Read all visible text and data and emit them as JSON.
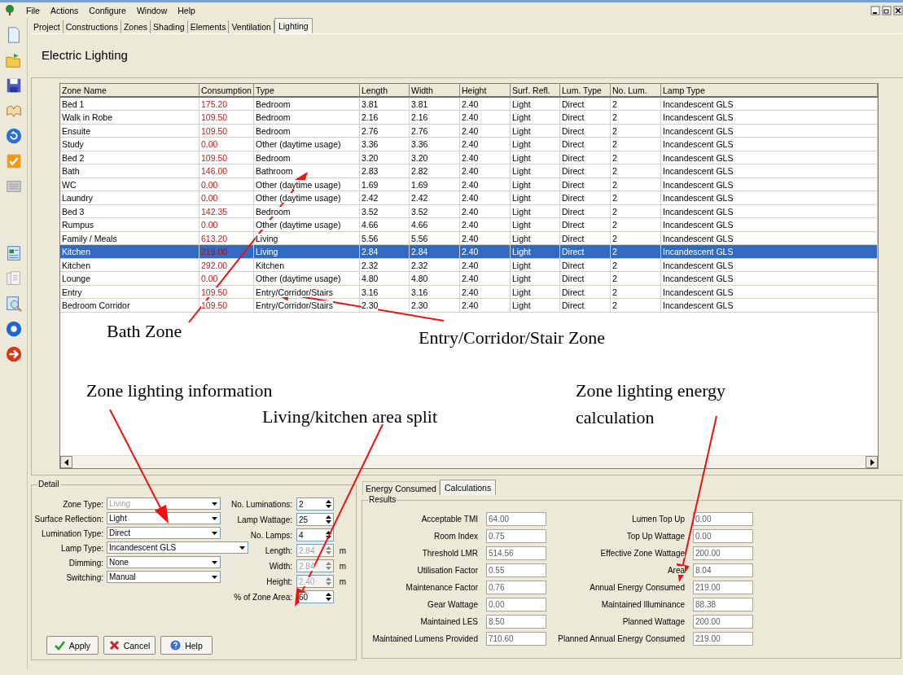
{
  "menu": [
    "File",
    "Actions",
    "Configure",
    "Window",
    "Help"
  ],
  "tabs": [
    {
      "label": "Project",
      "selected": false
    },
    {
      "label": "Constructions",
      "selected": false
    },
    {
      "label": "Zones",
      "selected": false
    },
    {
      "label": "Shading",
      "selected": false
    },
    {
      "label": "Elements",
      "selected": false
    },
    {
      "label": "Ventilation",
      "selected": false
    },
    {
      "label": "Lighting",
      "selected": true
    }
  ],
  "heading": "Electric Lighting",
  "table": {
    "columns": [
      "Zone Name",
      "Consumption",
      "Type",
      "Length",
      "Width",
      "Height",
      "Surf. Refl.",
      "Lum. Type",
      "No. Lum.",
      "Lamp Type"
    ],
    "rows": [
      {
        "cells": [
          "Bed 1",
          "175.20",
          "Bedroom",
          "3.81",
          "3.81",
          "2.40",
          "Light",
          "Direct",
          "2",
          "Incandescent GLS"
        ],
        "selected": false
      },
      {
        "cells": [
          "Walk in Robe",
          "109.50",
          "Bedroom",
          "2.16",
          "2.16",
          "2.40",
          "Light",
          "Direct",
          "2",
          "Incandescent GLS"
        ],
        "selected": false
      },
      {
        "cells": [
          "Ensuite",
          "109.50",
          "Bedroom",
          "2.76",
          "2.76",
          "2.40",
          "Light",
          "Direct",
          "2",
          "Incandescent GLS"
        ],
        "selected": false
      },
      {
        "cells": [
          "Study",
          "0.00",
          "Other (daytime usage)",
          "3.36",
          "3.36",
          "2.40",
          "Light",
          "Direct",
          "2",
          "Incandescent GLS"
        ],
        "selected": false
      },
      {
        "cells": [
          "Bed 2",
          "109.50",
          "Bedroom",
          "3.20",
          "3.20",
          "2.40",
          "Light",
          "Direct",
          "2",
          "Incandescent GLS"
        ],
        "selected": false
      },
      {
        "cells": [
          "Bath",
          "146.00",
          "Bathroom",
          "2.83",
          "2.82",
          "2.40",
          "Light",
          "Direct",
          "2",
          "Incandescent GLS"
        ],
        "selected": false
      },
      {
        "cells": [
          "WC",
          "0.00",
          "Other (daytime usage)",
          "1.69",
          "1.69",
          "2.40",
          "Light",
          "Direct",
          "2",
          "Incandescent GLS"
        ],
        "selected": false
      },
      {
        "cells": [
          "Laundry",
          "0.00",
          "Other (daytime usage)",
          "2.42",
          "2.42",
          "2.40",
          "Light",
          "Direct",
          "2",
          "Incandescent GLS"
        ],
        "selected": false
      },
      {
        "cells": [
          "Bed 3",
          "142.35",
          "Bedroom",
          "3.52",
          "3.52",
          "2.40",
          "Light",
          "Direct",
          "2",
          "Incandescent GLS"
        ],
        "selected": false
      },
      {
        "cells": [
          "Rumpus",
          "0.00",
          "Other (daytime usage)",
          "4.66",
          "4.66",
          "2.40",
          "Light",
          "Direct",
          "2",
          "Incandescent GLS"
        ],
        "selected": false
      },
      {
        "cells": [
          "Family / Meals",
          "613.20",
          "Living",
          "5.56",
          "5.56",
          "2.40",
          "Light",
          "Direct",
          "2",
          "Incandescent GLS"
        ],
        "selected": false
      },
      {
        "cells": [
          "Kitchen",
          "219.00",
          "Living",
          "2.84",
          "2.84",
          "2.40",
          "Light",
          "Direct",
          "2",
          "Incandescent GLS"
        ],
        "selected": true
      },
      {
        "cells": [
          "Kitchen",
          "292.00",
          "Kitchen",
          "2.32",
          "2.32",
          "2.40",
          "Light",
          "Direct",
          "2",
          "Incandescent GLS"
        ],
        "selected": false
      },
      {
        "cells": [
          "Lounge",
          "0.00",
          "Other (daytime usage)",
          "4.80",
          "4.80",
          "2.40",
          "Light",
          "Direct",
          "2",
          "Incandescent GLS"
        ],
        "selected": false
      },
      {
        "cells": [
          "Entry",
          "109.50",
          "Entry/Corridor/Stairs",
          "3.16",
          "3.16",
          "2.40",
          "Light",
          "Direct",
          "2",
          "Incandescent GLS"
        ],
        "selected": false
      },
      {
        "cells": [
          "Bedroom Corridor",
          "109.50",
          "Entry/Corridor/Stairs",
          "2.30",
          "2.30",
          "2.40",
          "Light",
          "Direct",
          "2",
          "Incandescent GLS"
        ],
        "selected": false
      }
    ]
  },
  "detail": {
    "title": "Detail",
    "combos": [
      {
        "label": "Zone Type:",
        "value": "Living",
        "disabled": true
      },
      {
        "label": "Surface Reflection:",
        "value": "Light",
        "disabled": false
      },
      {
        "label": "Lumination Type:",
        "value": "Direct",
        "disabled": false
      },
      {
        "label": "Lamp Type:",
        "value": "Incandescent GLS",
        "disabled": false
      },
      {
        "label": "Dimming:",
        "value": "None",
        "disabled": false
      },
      {
        "label": "Switching:",
        "value": "Manual",
        "disabled": false
      }
    ],
    "spinners": [
      {
        "label": "No. Luminations:",
        "value": "2",
        "disabled": false
      },
      {
        "label": "Lamp Wattage:",
        "value": "25",
        "disabled": false
      },
      {
        "label": "No. Lamps:",
        "value": "4",
        "disabled": false
      },
      {
        "label": "Length:",
        "value": "2.84",
        "disabled": true,
        "unit": "m"
      },
      {
        "label": "Width:",
        "value": "2.84",
        "disabled": true,
        "unit": "m"
      },
      {
        "label": "Height:",
        "value": "2.40",
        "disabled": true,
        "unit": "m"
      },
      {
        "label": "% of Zone Area:",
        "value": "60",
        "disabled": false
      }
    ],
    "buttons": [
      {
        "label": "Apply",
        "kind": "apply"
      },
      {
        "label": "Cancel",
        "kind": "cancel"
      },
      {
        "label": "Help",
        "kind": "help"
      }
    ]
  },
  "result_tabs": [
    {
      "label": "Energy Consumed",
      "selected": false
    },
    {
      "label": "Calculations",
      "selected": true
    }
  ],
  "results": {
    "title": "Results",
    "left": [
      {
        "label": "Acceptable TMI",
        "value": "64.00"
      },
      {
        "label": "Room Index",
        "value": "0.75"
      },
      {
        "label": "Threshold LMR",
        "value": "514.56"
      },
      {
        "label": "Utilisation Factor",
        "value": "0.55"
      },
      {
        "label": "Maintenance Factor",
        "value": "0.76"
      },
      {
        "label": "Gear Wattage",
        "value": "0.00"
      },
      {
        "label": "Maintained LES",
        "value": "8.50"
      },
      {
        "label": "Maintained Lumens Provided",
        "value": "710.60"
      }
    ],
    "right": [
      {
        "label": "Lumen Top Up",
        "value": "0.00"
      },
      {
        "label": "Top Up Wattage",
        "value": "0.00"
      },
      {
        "label": "Effective Zone Wattage",
        "value": "200.00"
      },
      {
        "label": "Area",
        "value": "8.04"
      },
      {
        "label": "Annual Energy Consumed",
        "value": "219.00"
      },
      {
        "label": "Maintained Illuminance",
        "value": "88.38"
      },
      {
        "label": "Planned Wattage",
        "value": "200.00"
      },
      {
        "label": "Planned Annual Energy Consumed",
        "value": "219.00"
      }
    ]
  },
  "annotations": [
    {
      "text": "Bath Zone"
    },
    {
      "text": "Entry/Corridor/Stair Zone"
    },
    {
      "text": "Zone lighting information"
    },
    {
      "text": "Living/kitchen area split"
    },
    {
      "text": "Zone lighting energy calculation"
    }
  ]
}
